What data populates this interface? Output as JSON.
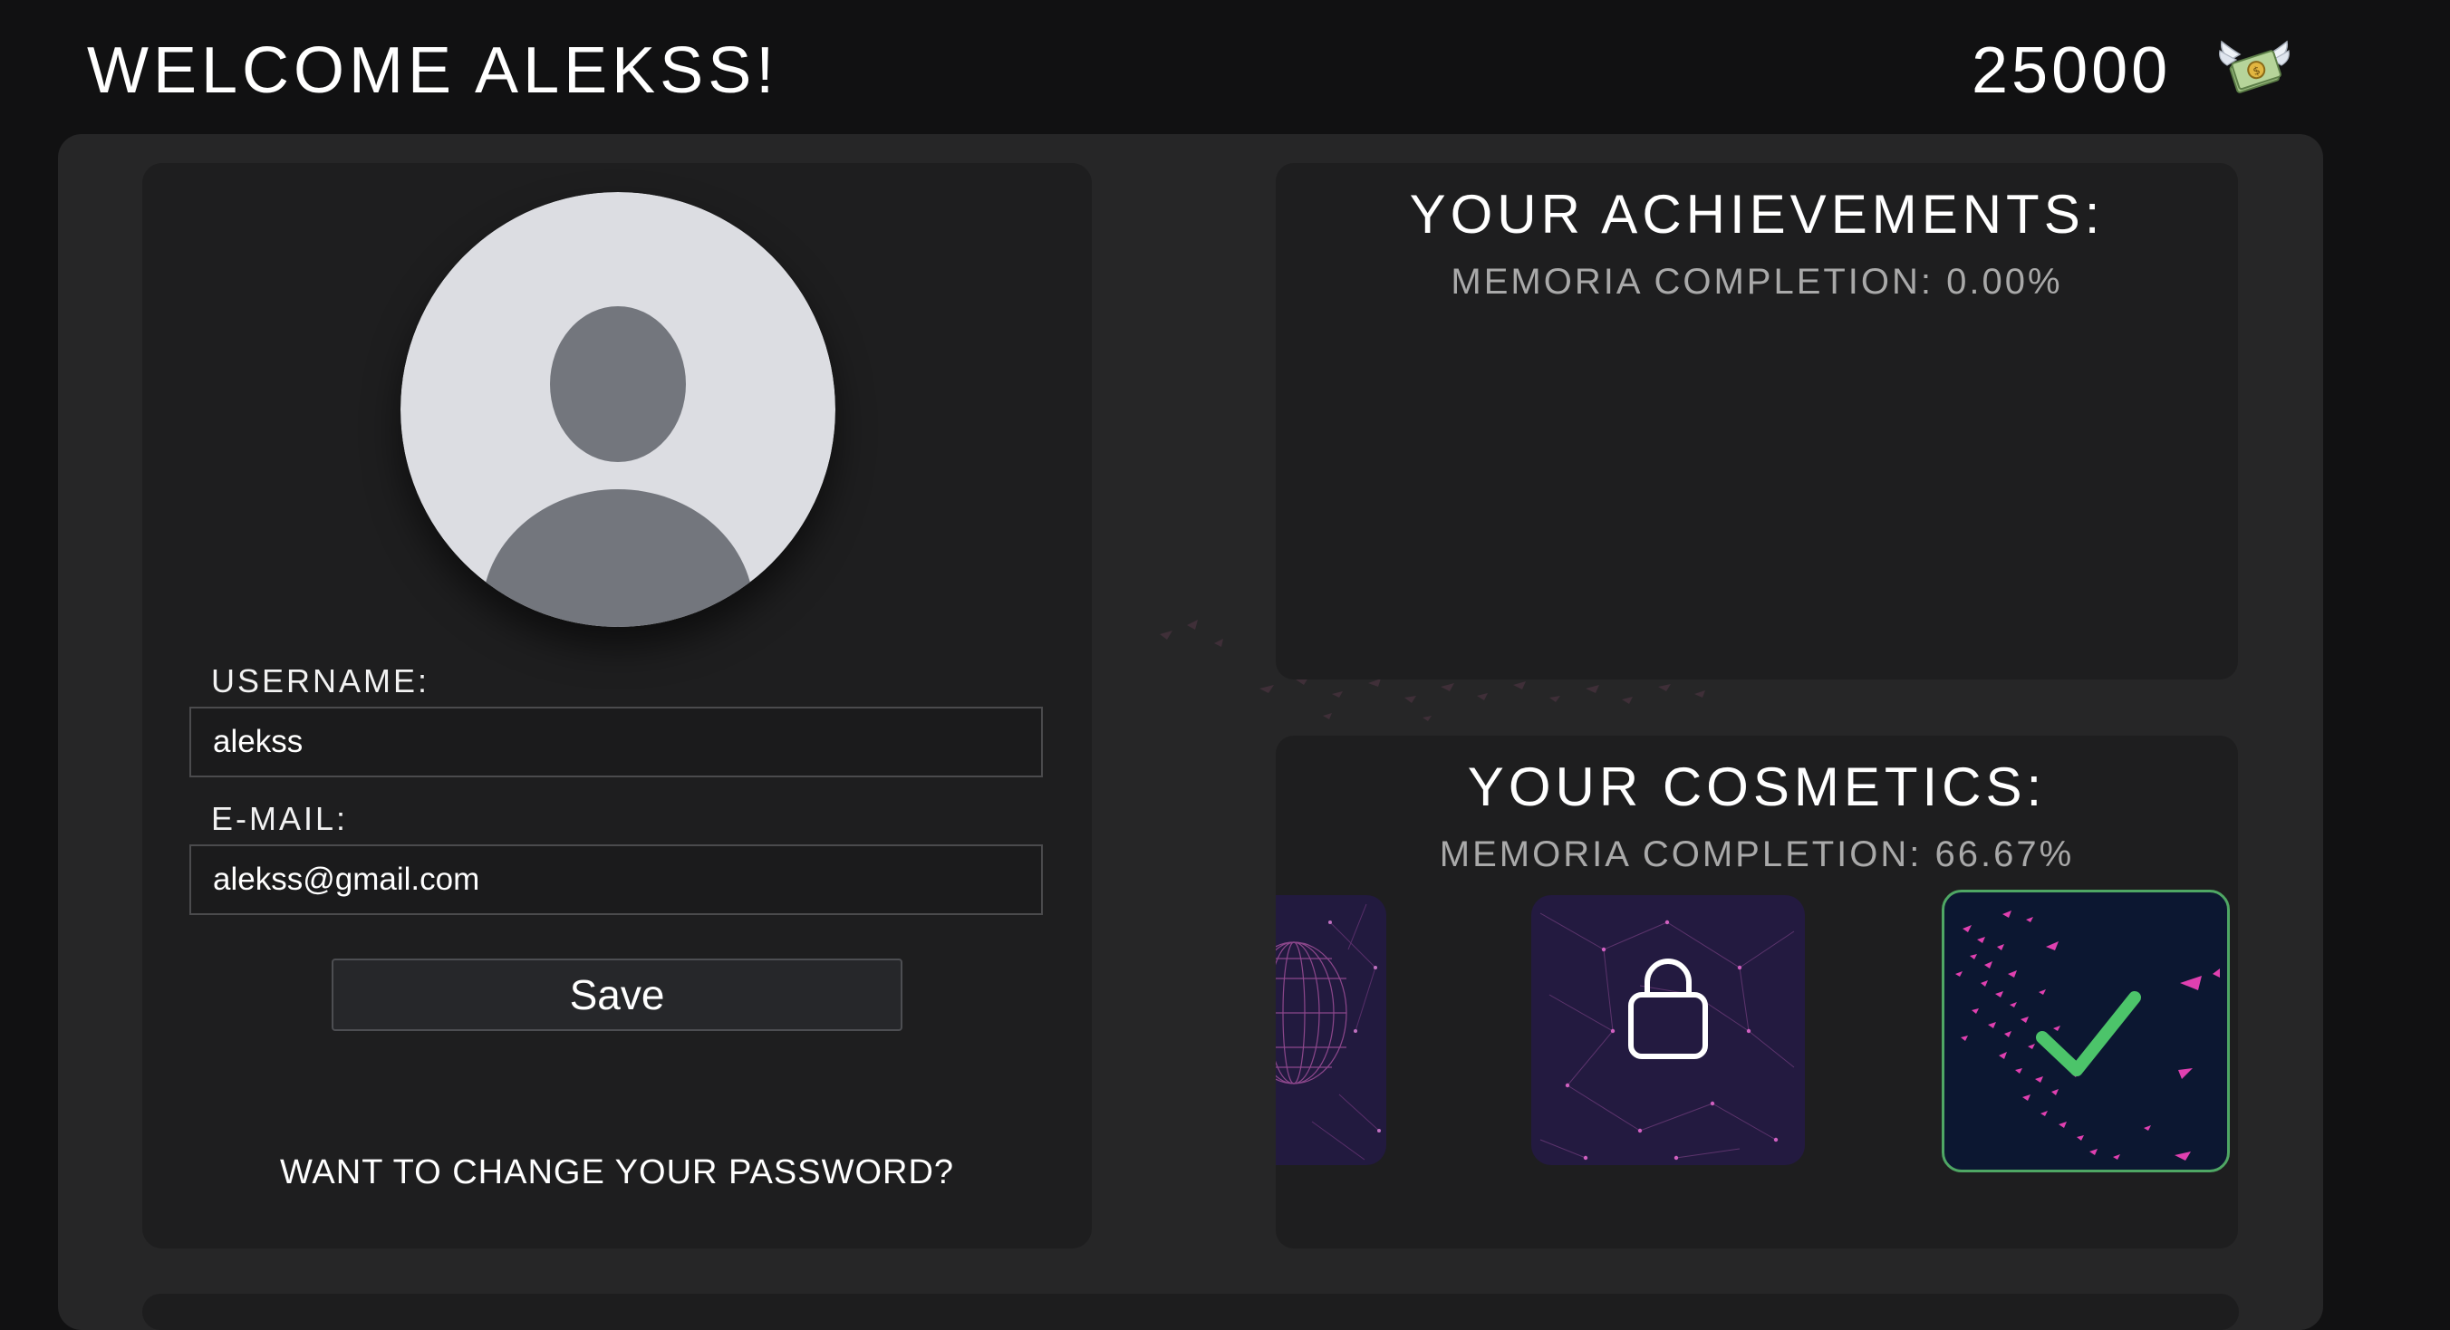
{
  "header": {
    "welcome_text": "WELCOME ALEKSS!",
    "coin_balance": "25000",
    "coin_icon": "money-with-wings-icon"
  },
  "profile": {
    "avatar_icon": "default-user-avatar-icon",
    "username_label": "USERNAME:",
    "username_value": "alekss",
    "email_label": "E-MAIL:",
    "email_value": "alekss@gmail.com",
    "save_label": "Save",
    "change_password_link": "WANT TO CHANGE YOUR PASSWORD?"
  },
  "achievements": {
    "title": "YOUR ACHIEVEMENTS:",
    "completion": "MEMORIA COMPLETION: 0.00%"
  },
  "cosmetics": {
    "title": "YOUR COSMETICS:",
    "completion": "MEMORIA COMPLETION: 66.67%",
    "items": [
      {
        "state": "owned",
        "theme": "purple-sphere-network"
      },
      {
        "state": "locked",
        "theme": "purple-network",
        "icon": "lock-icon"
      },
      {
        "state": "selected",
        "theme": "navy-pink-particles",
        "icon": "checkmark-icon"
      }
    ]
  },
  "colors": {
    "background": "#111112",
    "main_panel": "#262627",
    "card": "#1e1e1f",
    "selected_border": "#4fa764",
    "checkmark": "#4cc46a",
    "particle_pink": "#e040b0"
  }
}
